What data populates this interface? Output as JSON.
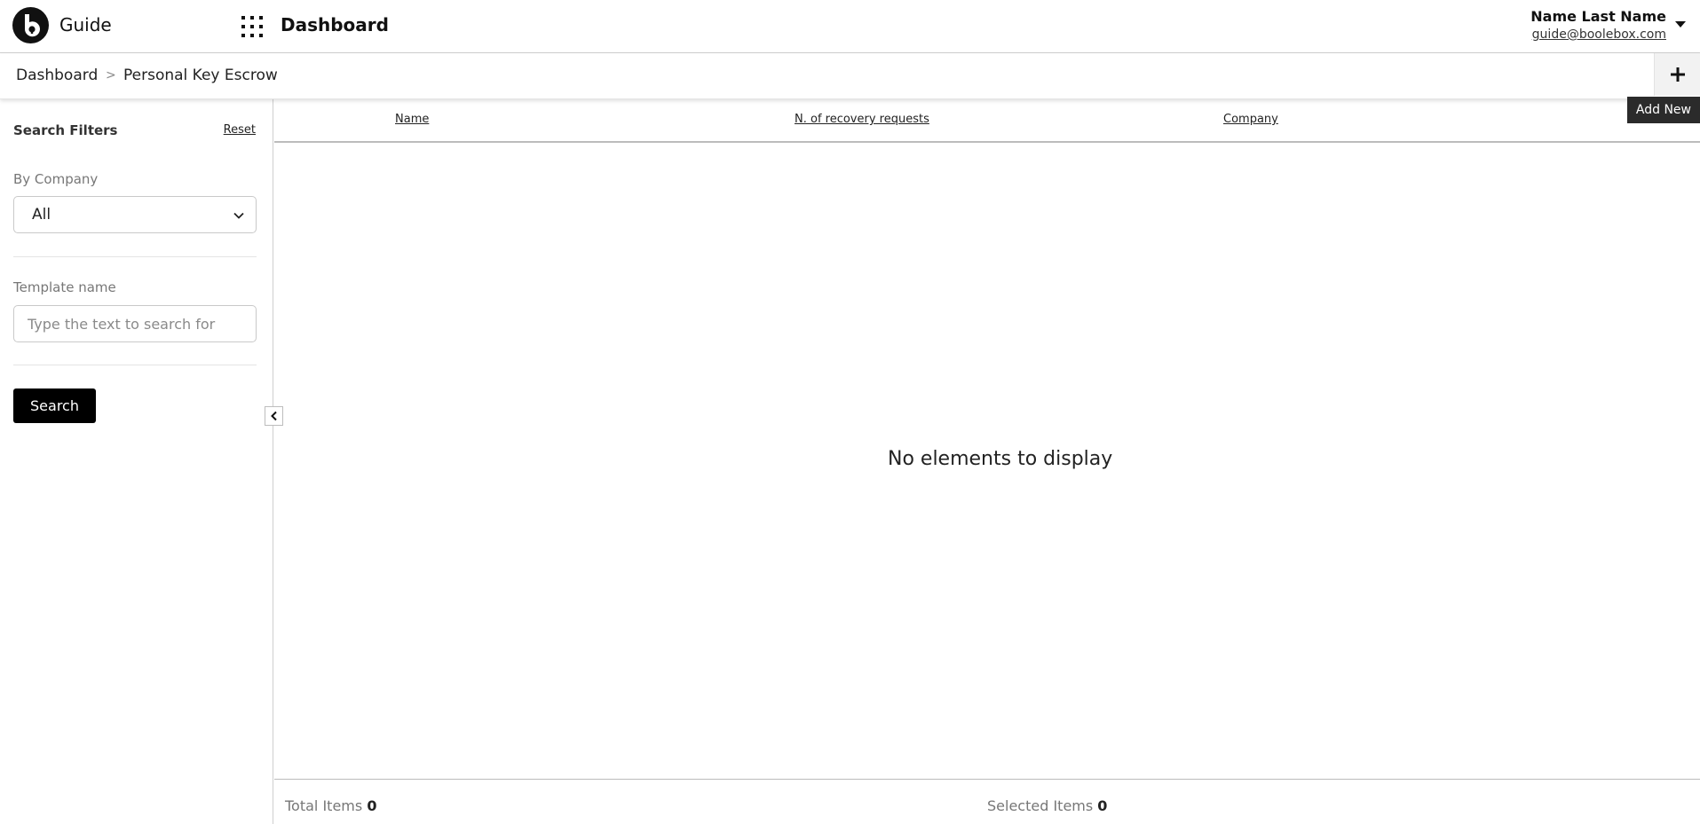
{
  "header": {
    "app_name": "Guide",
    "title": "Dashboard",
    "user_name": "Name Last Name",
    "user_email": "guide@boolebox.com",
    "logo_icon": "boolebox-logo",
    "apps_icon": "grid-apps-icon"
  },
  "breadcrumb": {
    "items": [
      "Dashboard",
      "Personal Key Escrow"
    ],
    "separator": ">"
  },
  "toolbar": {
    "add_tooltip": "Add New"
  },
  "filters": {
    "title": "Search Filters",
    "reset_label": "Reset",
    "company_label": "By Company",
    "company_value": "All",
    "template_label": "Template name",
    "template_placeholder": "Type the text to search for",
    "search_label": "Search"
  },
  "table": {
    "columns": [
      "Name",
      "N. of recovery requests",
      "Company"
    ],
    "empty_message": "No elements to display"
  },
  "footer": {
    "total_label": "Total Items",
    "total_value": "0",
    "selected_label": "Selected Items",
    "selected_value": "0"
  },
  "colors": {
    "primary": "#000000",
    "border": "#cfcfcf",
    "muted_text": "#777777"
  }
}
